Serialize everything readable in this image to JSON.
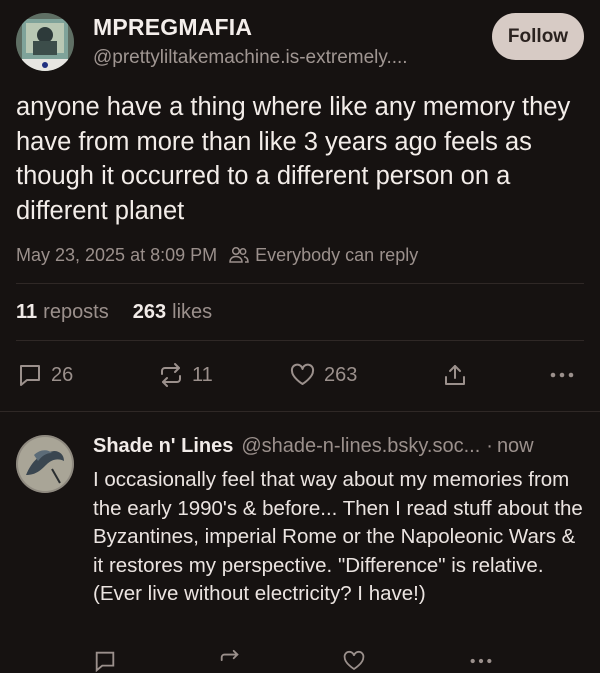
{
  "post": {
    "author_name": "MPREGMAFIA",
    "author_handle": "@prettyliltakemachine.is-extremely....",
    "follow_label": "Follow",
    "text": "anyone have a thing where like any memory they have from more than like 3 years ago feels as though it occurred to a different person on a different planet",
    "timestamp": "May 23, 2025 at 8:09 PM",
    "reply_setting": "Everybody can reply",
    "reposts_count": "11",
    "reposts_label": "reposts",
    "likes_count": "263",
    "likes_label": "likes",
    "actions": {
      "reply_count": "26",
      "repost_count": "11",
      "like_count": "263"
    }
  },
  "reply": {
    "author_name": "Shade n' Lines",
    "author_handle": "@shade-n-lines.bsky.soc...",
    "separator": "·",
    "time": "now",
    "text": "I occasionally feel that way about my memories from the early 1990's & before... Then I read stuff about the Byzantines, imperial Rome or the Napoleonic Wars & it restores my perspective. \"Difference\" is relative. (Ever live without electricity? I have!)"
  },
  "icons": {
    "reply": "speech-bubble-icon",
    "repost": "repost-arrows-icon",
    "like": "heart-icon",
    "share": "share-upload-icon",
    "more": "more-dots-icon",
    "people": "people-icon"
  },
  "colors": {
    "background": "#161211",
    "text": "#f1ebe8",
    "muted": "#9b908c",
    "follow_button": "#d7cbc5"
  }
}
